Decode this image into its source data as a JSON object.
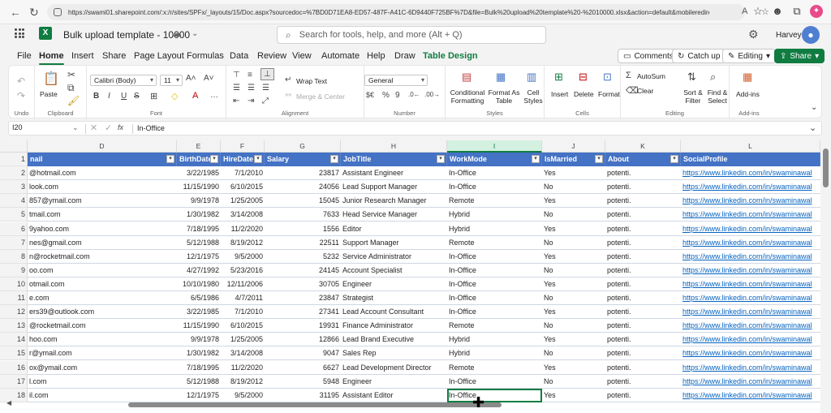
{
  "browser": {
    "url": "https://swami01.sharepoint.com/:x:/r/sites/SPFx/_layouts/15/Doc.aspx?sourcedoc=%7BD0D71EA8-ED57-487F-A41C-6D9440F725BF%7D&file=Bulk%20upload%20template%20-%2010000.xlsx&action=default&mobileredirect=true"
  },
  "app": {
    "doc_title": "Bulk upload template - 10000",
    "search_placeholder": "Search for tools, help, and more (Alt + Q)",
    "user": "Harvey"
  },
  "tabs": [
    "File",
    "Home",
    "Insert",
    "Share",
    "Page Layout",
    "Formulas",
    "Data",
    "Review",
    "View",
    "Automate",
    "Help",
    "Draw",
    "Table Design"
  ],
  "active_tab": "Home",
  "header_actions": {
    "comments": "Comments",
    "catchup": "Catch up",
    "editing": "Editing",
    "share": "Share"
  },
  "ribbon": {
    "undo_label": "Undo",
    "paste": "Paste",
    "clipboard": "Clipboard",
    "font_name": "Calibri (Body)",
    "font_size": "11",
    "font_group": "Font",
    "wrap_text": "Wrap Text",
    "merge_center": "Merge & Center",
    "alignment": "Alignment",
    "number_format": "General",
    "number": "Number",
    "conditional_formatting": "Conditional Formatting",
    "format_as_table": "Format As Table",
    "cell_styles": "Cell Styles",
    "styles": "Styles",
    "insert": "Insert",
    "delete": "Delete",
    "format": "Format",
    "cells": "Cells",
    "autosum": "AutoSum",
    "clear": "Clear",
    "sort_filter": "Sort & Filter",
    "find_select": "Find & Select",
    "editing": "Editing",
    "addins": "Add-ins",
    "addins_group": "Add-ins"
  },
  "formula_bar": {
    "cell_ref": "I20",
    "formula": "In-Office"
  },
  "columns": [
    "D",
    "E",
    "F",
    "G",
    "H",
    "I",
    "J",
    "K",
    "L"
  ],
  "table_headers": [
    "nail",
    "BirthDate",
    "HireDate",
    "Salary",
    "JobTitle",
    "WorkMode",
    "IsMarried",
    "About",
    "SocialProfile"
  ],
  "rows": [
    {
      "n": "2",
      "email": "@hotmail.com",
      "birth": "3/22/1985",
      "hire": "7/1/2010",
      "salary": "23817",
      "job": "Assistant Engineer",
      "mode": "In-Office",
      "married": "Yes",
      "about": "potenti.",
      "social": "https://www.linkedin.com/in/swaminawal"
    },
    {
      "n": "3",
      "email": "look.com",
      "birth": "11/15/1990",
      "hire": "6/10/2015",
      "salary": "24056",
      "job": "Lead Support Manager",
      "mode": "In-Office",
      "married": "No",
      "about": "potenti.",
      "social": "https://www.linkedin.com/in/swaminawal"
    },
    {
      "n": "4",
      "email": "857@ymail.com",
      "birth": "9/9/1978",
      "hire": "1/25/2005",
      "salary": "15045",
      "job": "Junior Research Manager",
      "mode": "Remote",
      "married": "Yes",
      "about": "potenti.",
      "social": "https://www.linkedin.com/in/swaminawal"
    },
    {
      "n": "5",
      "email": "tmail.com",
      "birth": "1/30/1982",
      "hire": "3/14/2008",
      "salary": "7633",
      "job": "Head Service Manager",
      "mode": "Hybrid",
      "married": "No",
      "about": "potenti.",
      "social": "https://www.linkedin.com/in/swaminawal"
    },
    {
      "n": "6",
      "email": "9yahoo.com",
      "birth": "7/18/1995",
      "hire": "11/2/2020",
      "salary": "1556",
      "job": "Editor",
      "mode": "Hybrid",
      "married": "Yes",
      "about": "potenti.",
      "social": "https://www.linkedin.com/in/swaminawal"
    },
    {
      "n": "7",
      "email": "nes@gmail.com",
      "birth": "5/12/1988",
      "hire": "8/19/2012",
      "salary": "22511",
      "job": "Support Manager",
      "mode": "Remote",
      "married": "No",
      "about": "potenti.",
      "social": "https://www.linkedin.com/in/swaminawal"
    },
    {
      "n": "8",
      "email": "n@rocketmail.com",
      "birth": "12/1/1975",
      "hire": "9/5/2000",
      "salary": "5232",
      "job": "Service Administrator",
      "mode": "In-Office",
      "married": "Yes",
      "about": "potenti.",
      "social": "https://www.linkedin.com/in/swaminawal"
    },
    {
      "n": "9",
      "email": "oo.com",
      "birth": "4/27/1992",
      "hire": "5/23/2016",
      "salary": "24145",
      "job": "Account Specialist",
      "mode": "In-Office",
      "married": "No",
      "about": "potenti.",
      "social": "https://www.linkedin.com/in/swaminawal"
    },
    {
      "n": "10",
      "email": "otmail.com",
      "birth": "10/10/1980",
      "hire": "12/11/2006",
      "salary": "30705",
      "job": "Engineer",
      "mode": "In-Office",
      "married": "Yes",
      "about": "potenti.",
      "social": "https://www.linkedin.com/in/swaminawal"
    },
    {
      "n": "11",
      "email": "e.com",
      "birth": "6/5/1986",
      "hire": "4/7/2011",
      "salary": "23847",
      "job": "Strategist",
      "mode": "In-Office",
      "married": "No",
      "about": "potenti.",
      "social": "https://www.linkedin.com/in/swaminawal"
    },
    {
      "n": "12",
      "email": "ers39@outlook.com",
      "birth": "3/22/1985",
      "hire": "7/1/2010",
      "salary": "27341",
      "job": "Lead Account Consultant",
      "mode": "In-Office",
      "married": "Yes",
      "about": "potenti.",
      "social": "https://www.linkedin.com/in/swaminawal"
    },
    {
      "n": "13",
      "email": "@rocketmail.com",
      "birth": "11/15/1990",
      "hire": "6/10/2015",
      "salary": "19931",
      "job": "Finance Administrator",
      "mode": "Remote",
      "married": "No",
      "about": "potenti.",
      "social": "https://www.linkedin.com/in/swaminawal"
    },
    {
      "n": "14",
      "email": "hoo.com",
      "birth": "9/9/1978",
      "hire": "1/25/2005",
      "salary": "12866",
      "job": "Lead Brand Executive",
      "mode": "Hybrid",
      "married": "Yes",
      "about": "potenti.",
      "social": "https://www.linkedin.com/in/swaminawal"
    },
    {
      "n": "15",
      "email": "r@ymail.com",
      "birth": "1/30/1982",
      "hire": "3/14/2008",
      "salary": "9047",
      "job": "Sales Rep",
      "mode": "Hybrid",
      "married": "No",
      "about": "potenti.",
      "social": "https://www.linkedin.com/in/swaminawal"
    },
    {
      "n": "16",
      "email": "ox@ymail.com",
      "birth": "7/18/1995",
      "hire": "11/2/2020",
      "salary": "6627",
      "job": "Lead Development Director",
      "mode": "Remote",
      "married": "Yes",
      "about": "potenti.",
      "social": "https://www.linkedin.com/in/swaminawal"
    },
    {
      "n": "17",
      "email": "l.com",
      "birth": "5/12/1988",
      "hire": "8/19/2012",
      "salary": "5948",
      "job": "Engineer",
      "mode": "In-Office",
      "married": "No",
      "about": "potenti.",
      "social": "https://www.linkedin.com/in/swaminawal"
    },
    {
      "n": "18",
      "email": "il.com",
      "birth": "12/1/1975",
      "hire": "9/5/2000",
      "salary": "31195",
      "job": "Assistant Editor",
      "mode": "In-Office",
      "married": "Yes",
      "about": "potenti.",
      "social": "https://www.linkedin.com/in/swaminawal"
    }
  ],
  "colors": {
    "excel_green": "#107c41",
    "table_header": "#4472c4",
    "link": "#0563c1"
  }
}
